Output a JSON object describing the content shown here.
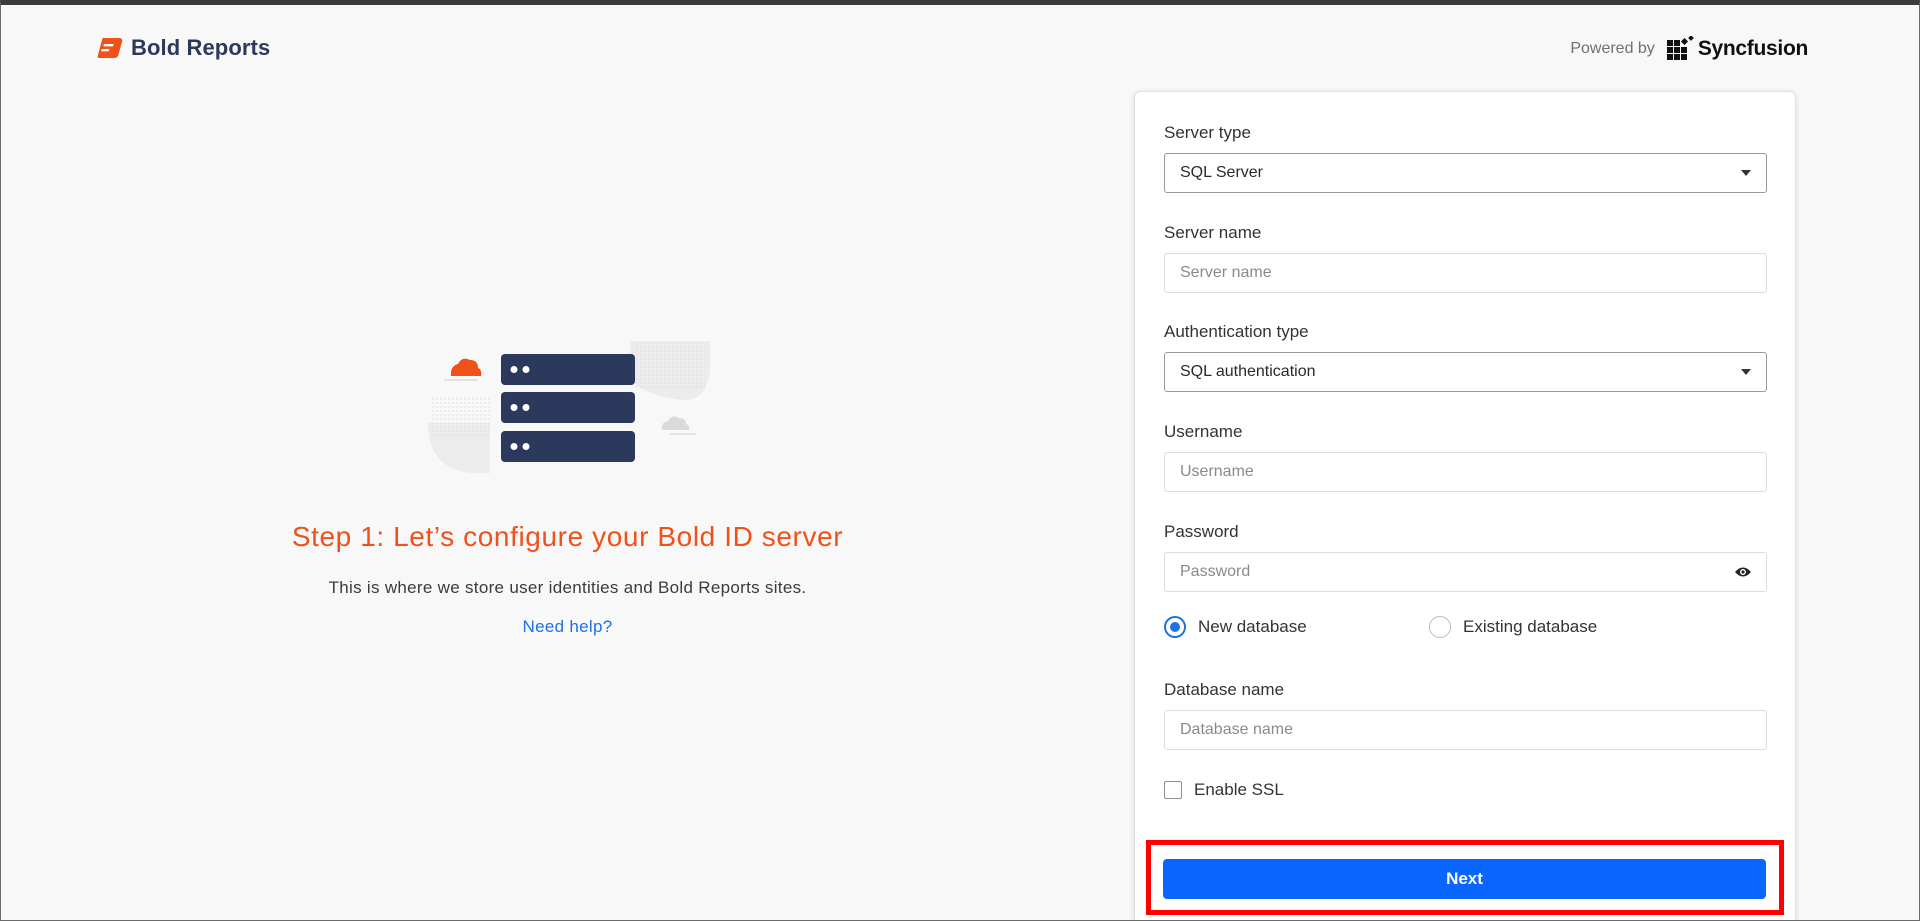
{
  "header": {
    "brand_name": "Bold Reports",
    "powered_by_label": "Powered by",
    "partner_name": "Syncfusion"
  },
  "intro": {
    "title": "Step 1: Let’s configure your Bold ID server",
    "subtitle": "This is where we store user identities and Bold Reports sites.",
    "help_link": "Need help?"
  },
  "form": {
    "server_type": {
      "label": "Server type",
      "value": "SQL Server"
    },
    "server_name": {
      "label": "Server name",
      "placeholder": "Server name",
      "value": ""
    },
    "auth_type": {
      "label": "Authentication type",
      "value": "SQL authentication"
    },
    "username": {
      "label": "Username",
      "placeholder": "Username",
      "value": ""
    },
    "password": {
      "label": "Password",
      "placeholder": "Password",
      "value": ""
    },
    "database_mode": {
      "options": [
        {
          "label": "New database",
          "selected": true
        },
        {
          "label": "Existing database",
          "selected": false
        }
      ]
    },
    "database_name": {
      "label": "Database name",
      "placeholder": "Database name",
      "value": ""
    },
    "enable_ssl": {
      "label": "Enable SSL",
      "checked": false
    },
    "next_button": "Next"
  },
  "colors": {
    "accent_orange": "#f0511a",
    "primary_blue": "#0a66ff",
    "navy": "#2b3a5c",
    "highlight_red": "#ff0000"
  },
  "icons": [
    "bold-reports-logo-icon",
    "syncfusion-logo-icon",
    "dropdown-caret-icon",
    "eye-icon",
    "server-illustration"
  ]
}
